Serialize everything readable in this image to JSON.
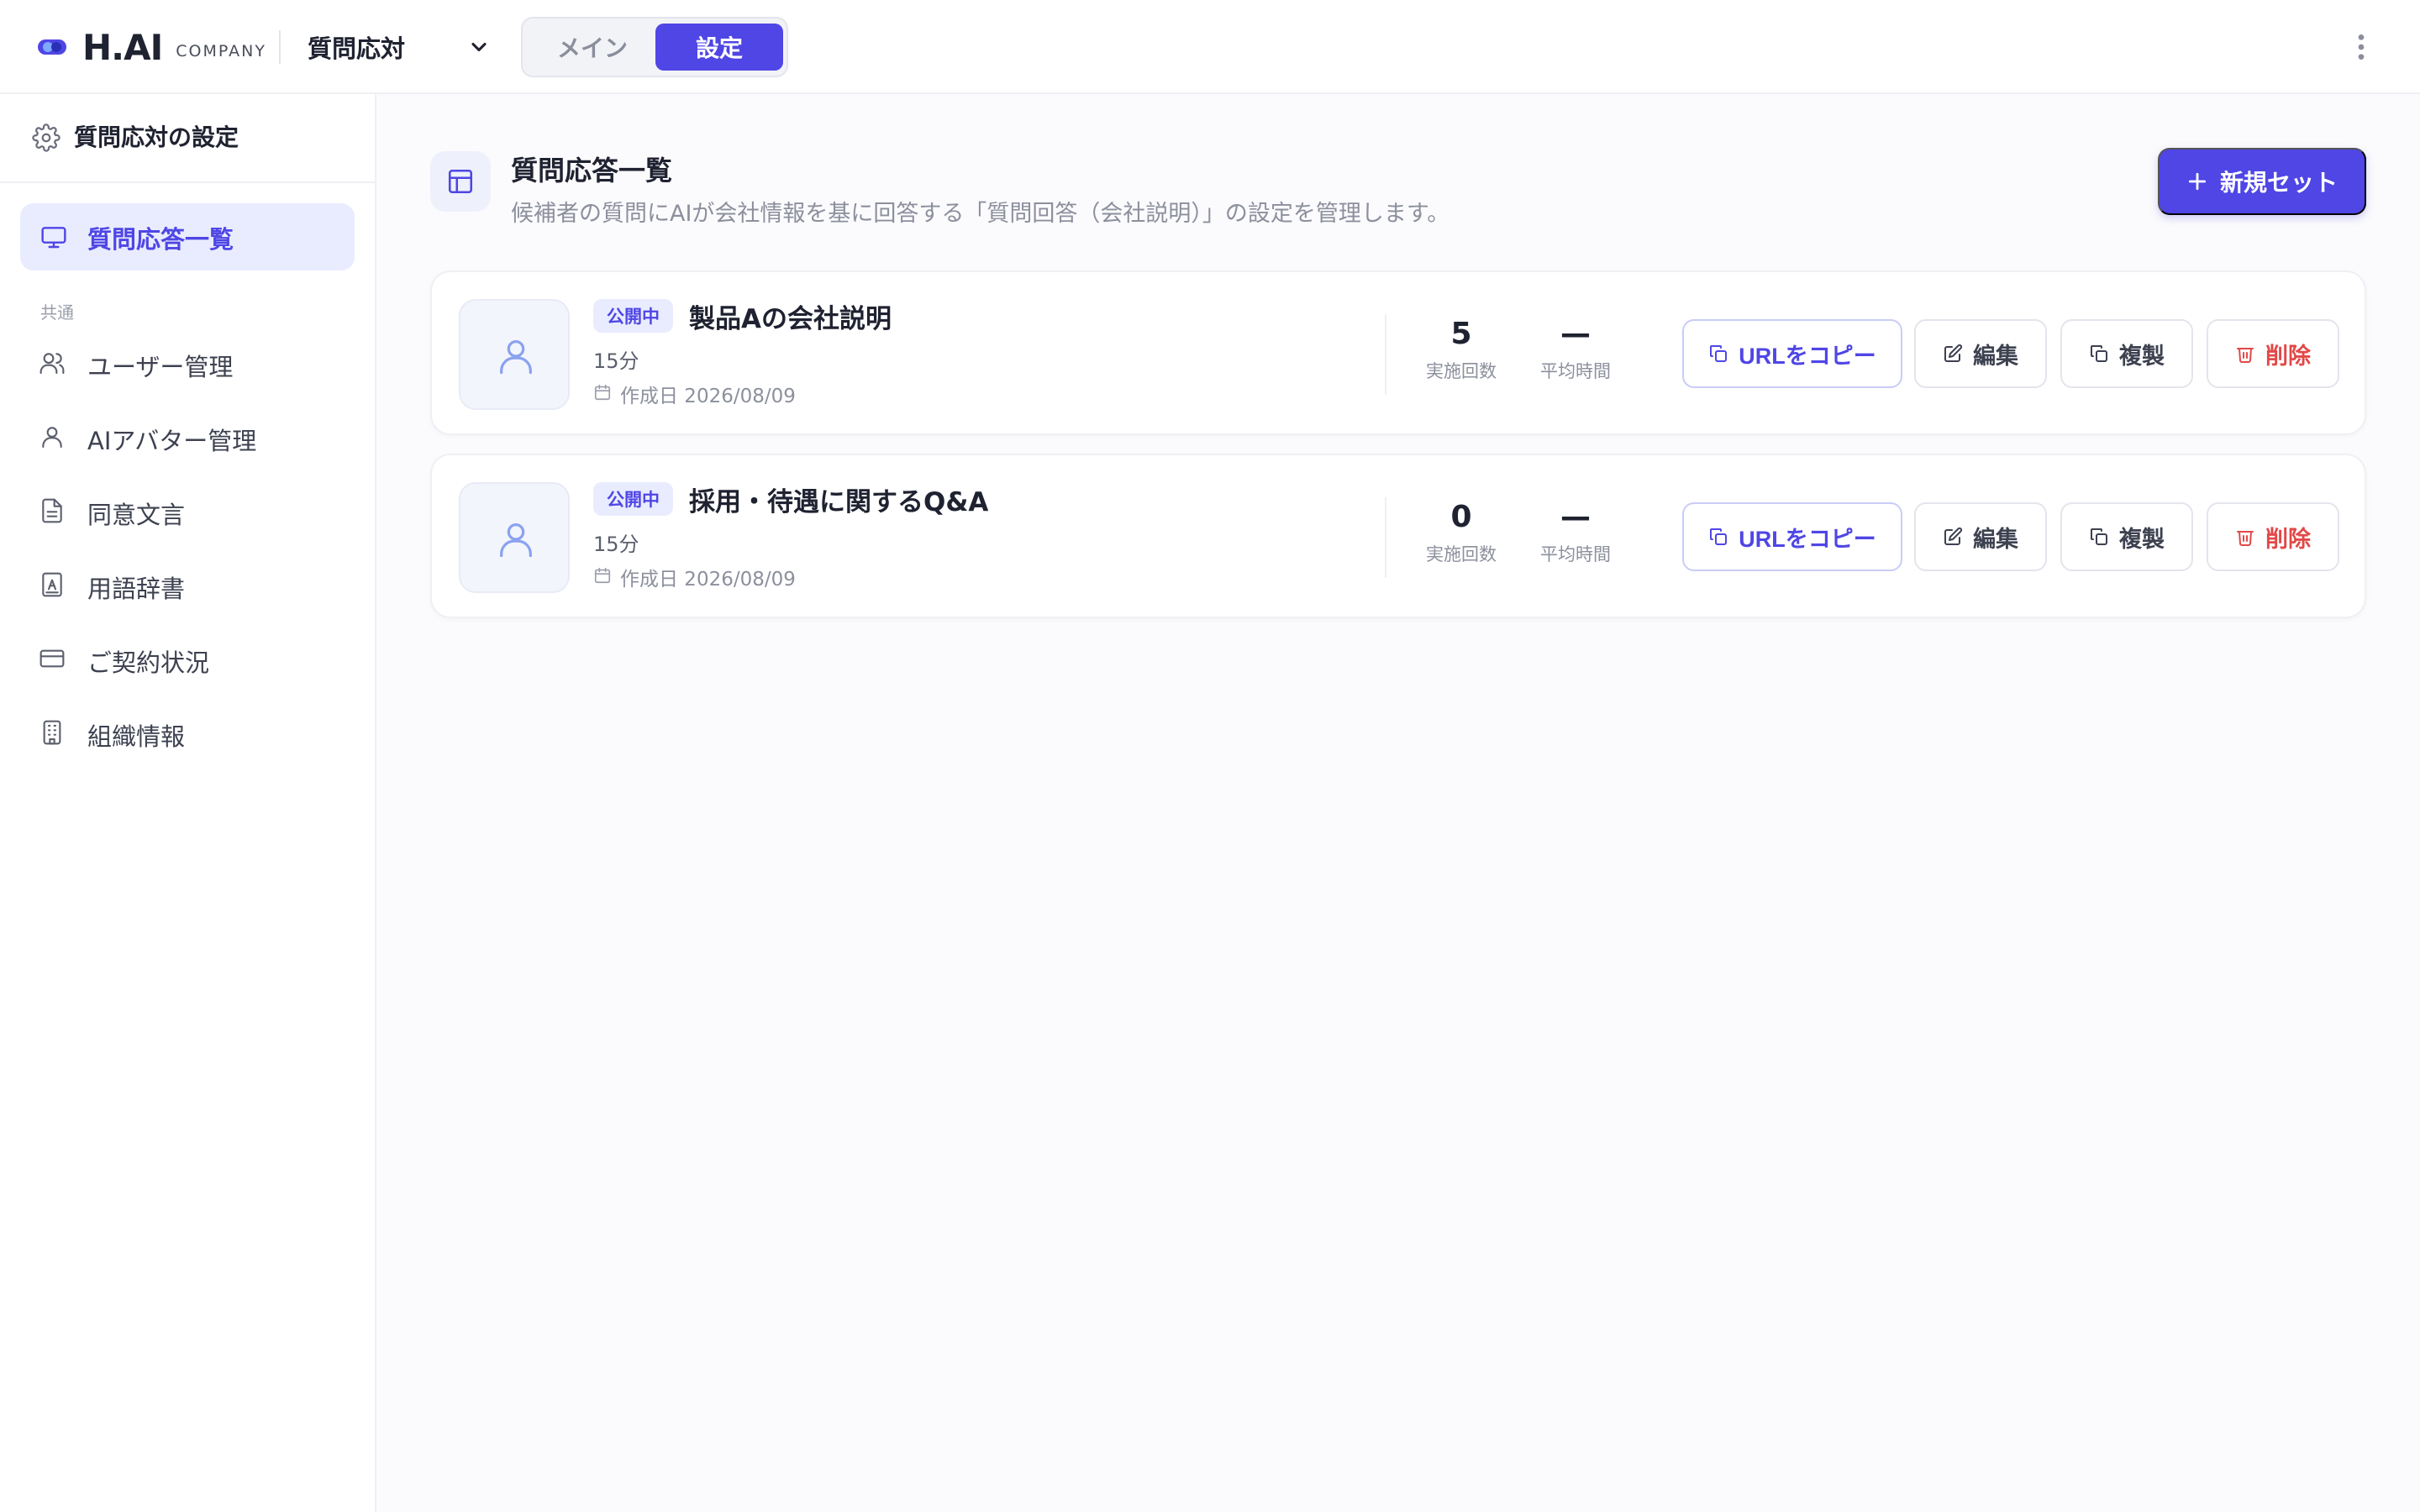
{
  "header": {
    "logo_text": "H.AI",
    "logo_sub": "COMPANY",
    "app_select": "質問応対",
    "mode_tabs": [
      {
        "label": "メイン",
        "active": false
      },
      {
        "label": "設定",
        "active": true
      }
    ]
  },
  "sidebar": {
    "title": "質問応対の設定",
    "active_item": {
      "label": "質問応答一覧",
      "icon": "monitor-icon"
    },
    "section_label": "共通",
    "items": [
      {
        "label": "ユーザー管理",
        "icon": "users-icon"
      },
      {
        "label": "AIアバター管理",
        "icon": "user-icon"
      },
      {
        "label": "同意文言",
        "icon": "document-icon"
      },
      {
        "label": "用語辞書",
        "icon": "dictionary-icon"
      },
      {
        "label": "ご契約状況",
        "icon": "credit-card-icon"
      },
      {
        "label": "組織情報",
        "icon": "building-icon"
      }
    ]
  },
  "main": {
    "title": "質問応答一覧",
    "description": "候補者の質問にAIが会社情報を基に回答する「質問回答（会社説明）」の設定を管理します。",
    "new_button": "新規セット",
    "cards": [
      {
        "status": "公開中",
        "title": "製品Aの会社説明",
        "duration": "15分",
        "created": "作成日 2026/08/09",
        "stats": {
          "count_value": "5",
          "count_label": "実施回数",
          "avg_value": "—",
          "avg_label": "平均時間"
        },
        "actions": {
          "copy": "URLをコピー",
          "edit": "編集",
          "duplicate": "複製",
          "delete": "削除"
        }
      },
      {
        "status": "公開中",
        "title": "採用・待遇に関するQ&A",
        "duration": "15分",
        "created": "作成日 2026/08/09",
        "stats": {
          "count_value": "0",
          "count_label": "実施回数",
          "avg_value": "—",
          "avg_label": "平均時間"
        },
        "actions": {
          "copy": "URLをコピー",
          "edit": "編集",
          "duplicate": "複製",
          "delete": "削除"
        }
      }
    ]
  },
  "colors": {
    "accent": "#4f46e5",
    "accent_soft": "#e9ecfe",
    "danger": "#e24848",
    "text": "#1f2230",
    "muted": "#8c909d"
  }
}
